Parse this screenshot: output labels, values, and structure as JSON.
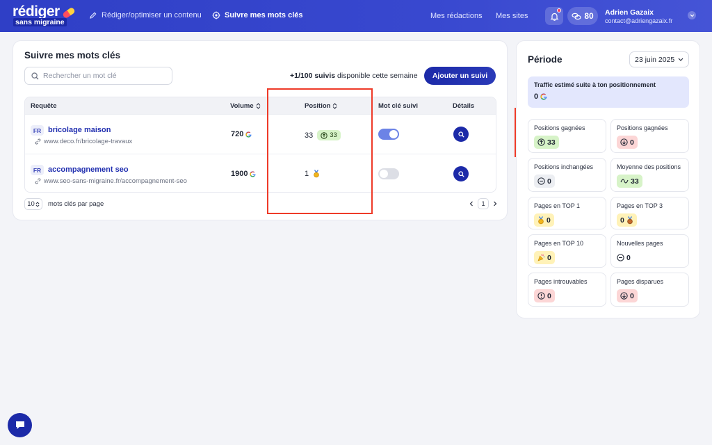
{
  "brand": {
    "line1": "rédiger",
    "line2": "sans migraine"
  },
  "nav": {
    "items": [
      {
        "label": "Rédiger/optimiser un contenu",
        "icon": "pencil-icon"
      },
      {
        "label": "Suivre mes mots clés",
        "icon": "target-icon"
      }
    ],
    "links": [
      "Mes rédactions",
      "Mes sites"
    ],
    "credits": "80",
    "user": {
      "name": "Adrien Gazaix",
      "email": "contact@adriengazaix.fr"
    }
  },
  "main": {
    "title": "Suivre mes mots clés",
    "search_placeholder": "Rechercher un mot clé",
    "quota_bold": "+1/100 suivis",
    "quota_rest": " disponible cette semaine",
    "add_label": "Ajouter un suivi",
    "columns": {
      "query": "Requête",
      "volume": "Volume",
      "position": "Position",
      "tracked": "Mot clé suivi",
      "details": "Détails"
    },
    "rows": [
      {
        "lang": "FR",
        "keyword": "bricolage maison",
        "url": "www.deco.fr/bricolage-travaux",
        "volume": "720",
        "position": "33",
        "gain": "33",
        "tracked": true
      },
      {
        "lang": "FR",
        "keyword": "accompagnement seo",
        "url": "www.seo-sans-migraine.fr/accompagnement-seo",
        "volume": "1900",
        "position": "1",
        "medal": "gold-medal-icon",
        "tracked": false
      }
    ],
    "per_page_value": "10",
    "per_page_label": "mots clés par page",
    "page": "1"
  },
  "side": {
    "title": "Période",
    "date": "23 juin 2025",
    "traffic_label": "Traffic estimé suite à ton positionnement",
    "traffic_value": "0",
    "stats": [
      {
        "label": "Positions gagnées",
        "value": "33",
        "icon": "arrow-up-circle-icon",
        "tone": "green"
      },
      {
        "label": "Positions gagnées",
        "value": "0",
        "icon": "arrow-down-circle-icon",
        "tone": "red"
      },
      {
        "label": "Positions inchangées",
        "value": "0",
        "icon": "minus-circle-icon",
        "tone": "gray"
      },
      {
        "label": "Moyenne des positions",
        "value": "33",
        "icon": "wave-icon",
        "tone": "mint"
      },
      {
        "label": "Pages en TOP 1",
        "value": "0",
        "icon": "gold-medal-icon",
        "tone": "yellow"
      },
      {
        "label": "Pages en TOP 3",
        "value": "0",
        "icon": "bronze-medal-icon",
        "tone": "yellow"
      },
      {
        "label": "Pages en TOP 10",
        "value": "0",
        "icon": "party-popper-icon",
        "tone": "yellow"
      },
      {
        "label": "Nouvelles pages",
        "value": "0",
        "icon": "minus-circle-icon",
        "tone": "gray"
      },
      {
        "label": "Pages introuvables",
        "value": "0",
        "icon": "alert-circle-icon",
        "tone": "red"
      },
      {
        "label": "Pages disparues",
        "value": "0",
        "icon": "arrow-down-circle-icon",
        "tone": "red"
      }
    ]
  },
  "colors": {
    "primary": "#1c2aa8",
    "annotation": "#ee3a28"
  }
}
